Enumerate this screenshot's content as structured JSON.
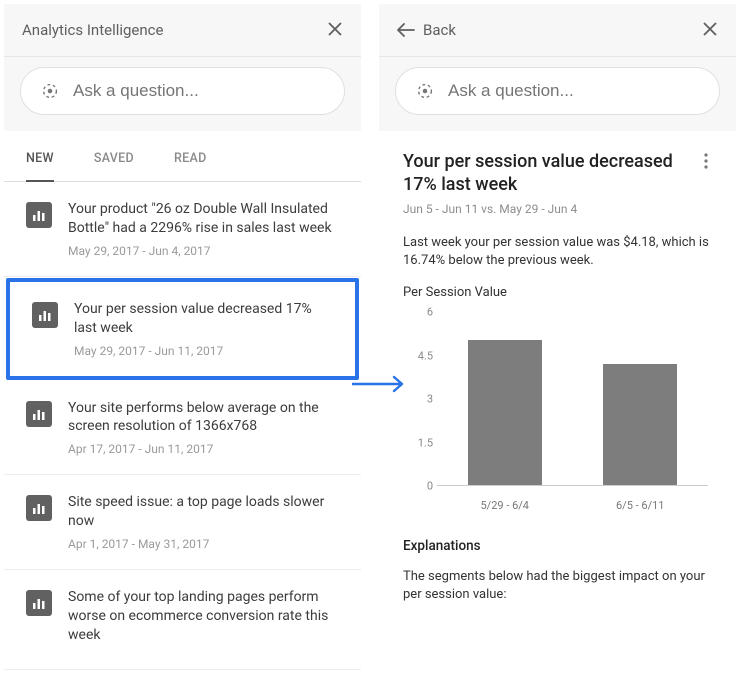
{
  "left": {
    "header_title": "Analytics Intelligence",
    "search_placeholder": "Ask a question...",
    "tabs": [
      "NEW",
      "SAVED",
      "READ"
    ],
    "active_tab": 0,
    "insights": [
      {
        "title": "Your product \"26 oz Double Wall Insulated Bottle\" had a 2296% rise in sales last week",
        "dates": "May 29, 2017 - Jun 4, 2017"
      },
      {
        "title": "Your per session value decreased 17% last week",
        "dates": "May 29, 2017 - Jun 11, 2017",
        "highlight": true
      },
      {
        "title": "Your site performs below average on the screen resolution of 1366x768",
        "dates": "Apr 17, 2017 - Jun 11, 2017"
      },
      {
        "title": "Site speed issue: a top page loads slower now",
        "dates": "Apr 1, 2017 - May 31, 2017"
      },
      {
        "title": "Some of your top landing pages perform worse on ecommerce conversion rate this week",
        "dates": ""
      }
    ]
  },
  "right": {
    "back_label": "Back",
    "search_placeholder": "Ask a question...",
    "title": "Your per session value decreased 17% last week",
    "date_range": "Jun 5 - Jun 11 vs. May 29 - Jun 4",
    "description": "Last week your per session value was $4.18, which is 16.74% below the previous week.",
    "chart_title": "Per Session Value",
    "explanations_head": "Explanations",
    "explanations_desc": "The segments below had the biggest impact on your per session value:"
  },
  "chart_data": {
    "type": "bar",
    "title": "Per Session Value",
    "categories": [
      "5/29 - 6/4",
      "6/5 - 6/11"
    ],
    "values": [
      5.02,
      4.18
    ],
    "ylabel": "",
    "xlabel": "",
    "ylim": [
      0,
      6
    ],
    "yticks": [
      0,
      1.5,
      3,
      4.5,
      6
    ]
  }
}
